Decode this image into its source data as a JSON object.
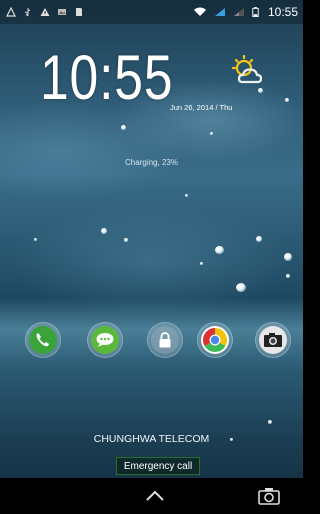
{
  "status_bar": {
    "time": "10:55",
    "left_icons": [
      "signal-alert-icon",
      "usb-icon",
      "warning-icon",
      "gallery-icon",
      "sd-card-icon"
    ],
    "right_icons": [
      "wifi-icon",
      "cell-signal-icon",
      "cell-signal-2-icon",
      "battery-icon"
    ]
  },
  "lockscreen": {
    "clock": "10:55",
    "date": "Jun 26, 2014 / Thu",
    "weather_icon": "partly-sunny-icon",
    "charging": "Charging, 23%"
  },
  "dock": {
    "items": [
      {
        "name": "phone",
        "icon": "phone-icon",
        "color": "#3aa33a"
      },
      {
        "name": "messaging",
        "icon": "message-icon",
        "color": "#5cb83d"
      },
      {
        "name": "unlock",
        "icon": "lock-icon",
        "color": "#8fa6b3"
      },
      {
        "name": "chrome",
        "icon": "chrome-icon",
        "color": "#d9463b"
      },
      {
        "name": "camera",
        "icon": "camera-icon",
        "color": "#e6e6e6"
      }
    ]
  },
  "carrier": "CHUNGHWA TELECOM",
  "emergency_label": "Emergency call",
  "navigation": {
    "up_icon": "chevron-up-icon",
    "camera_icon": "camera-icon"
  }
}
